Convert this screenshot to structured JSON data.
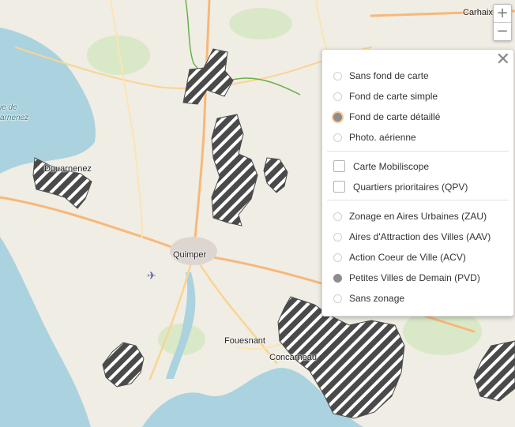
{
  "map": {
    "place_labels": {
      "carhaix": "Carhaix-P",
      "douarnenez": "Douarnenez",
      "quimper": "Quimper",
      "fouesnant": "Fouesnant",
      "concarneau": "Concarneau",
      "bay_line1": "ie de",
      "bay_line2": "arnenez"
    }
  },
  "zoom": {
    "in_label": "+",
    "out_label": "−"
  },
  "layers_panel": {
    "close_label": "✕",
    "base_maps": [
      {
        "label": "Sans fond de carte",
        "selected": false
      },
      {
        "label": "Fond de carte simple",
        "selected": false
      },
      {
        "label": "Fond de carte détaillé",
        "selected": true
      },
      {
        "label": "Photo. aérienne",
        "selected": false
      }
    ],
    "overlays": [
      {
        "label": "Carte Mobiliscope",
        "checked": false
      },
      {
        "label": "Quartiers prioritaires (QPV)",
        "checked": false
      }
    ],
    "zonings": [
      {
        "label": "Zonage en Aires Urbaines (ZAU)",
        "selected": false
      },
      {
        "label": "Aires d'Attraction des Villes (AAV)",
        "selected": false
      },
      {
        "label": "Action Coeur de Ville (ACV)",
        "selected": false
      },
      {
        "label": "Petites Villes de Demain (PVD)",
        "selected": true
      },
      {
        "label": "Sans zonage",
        "selected": false
      }
    ]
  },
  "colors": {
    "sea": "#aad3df",
    "land": "#f2efe9",
    "road_major": "#f7b87a",
    "hatch": "#4a4a4a",
    "selected_radio": "#8d8d8d"
  }
}
